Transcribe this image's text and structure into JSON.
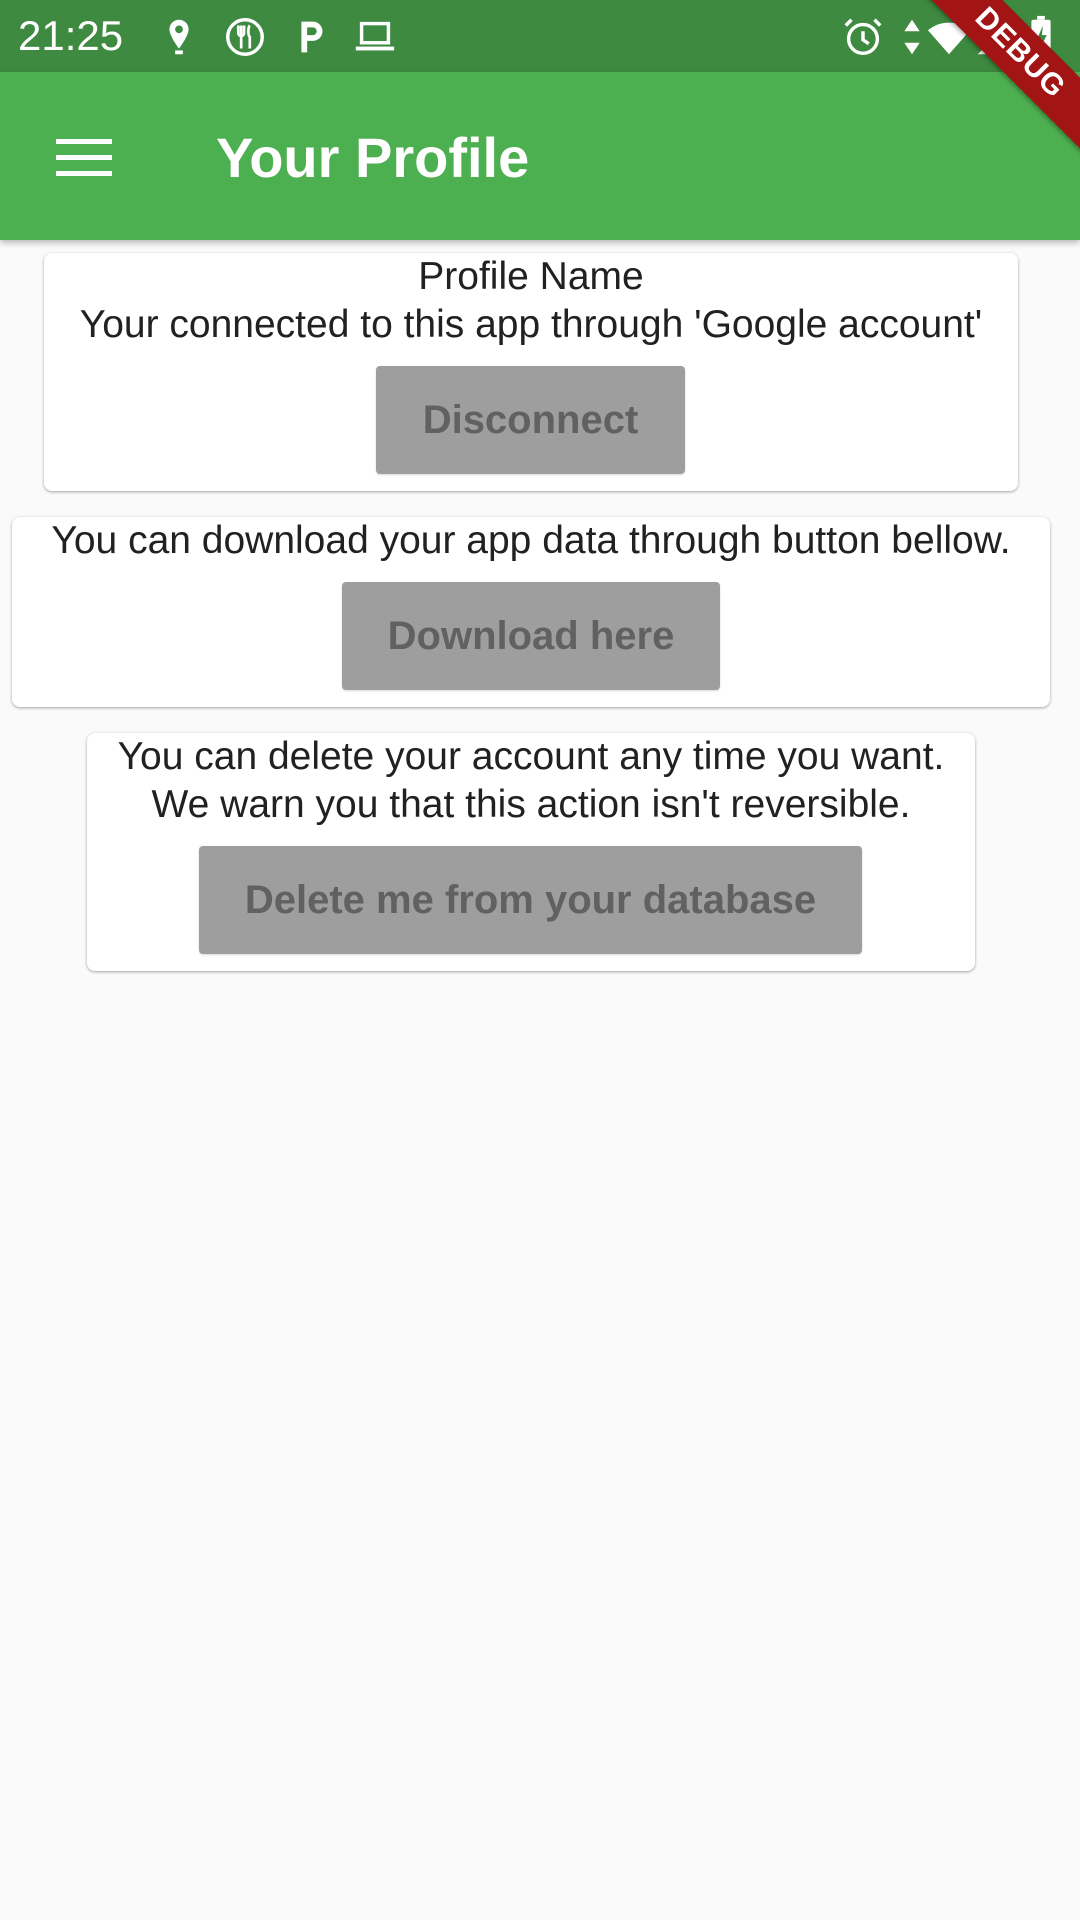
{
  "status_bar": {
    "time": "21:25",
    "left_icons": [
      "location-pin-icon",
      "food-delivery-icon",
      "parking-p-icon",
      "laptop-icon"
    ],
    "right_icons": [
      "alarm-clock-icon",
      "data-arrows-icon",
      "wifi-icon",
      "cell-signal-icon",
      "battery-charging-icon"
    ]
  },
  "debug_banner": "DEBUG",
  "app_bar": {
    "menu_icon": "hamburger-menu-icon",
    "title": "Your Profile",
    "color": "#4caf50"
  },
  "profile_card": {
    "name": "Profile Name",
    "connection_text": "Your connected to this app through 'Google account'",
    "button_label": "Disconnect"
  },
  "download_card": {
    "text": "You can download your app data through button bellow.",
    "button_label": "Download here"
  },
  "delete_card": {
    "line1": "You can delete your account any time you want.",
    "line2": "We warn you that this action isn't reversible.",
    "button_label": "Delete me from your database"
  },
  "colors": {
    "status_bar": "#3d8a40",
    "app_bar": "#4caf50",
    "button_bg": "#9e9e9e",
    "button_text": "#616161",
    "debug_banner": "#a31515",
    "background": "#fafafa"
  }
}
